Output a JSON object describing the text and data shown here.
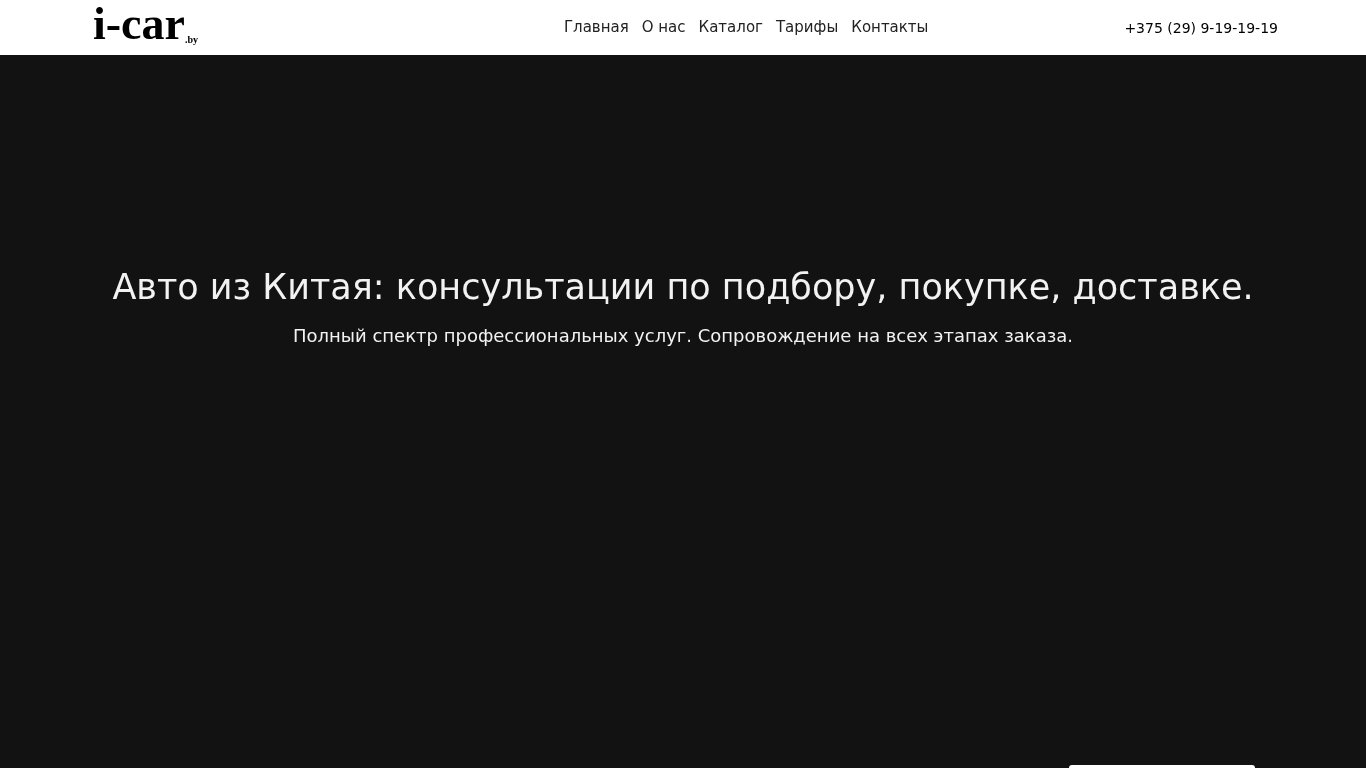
{
  "header": {
    "logo": {
      "name": "i-car",
      "suffix": ".by"
    },
    "nav": [
      {
        "label": "Главная"
      },
      {
        "label": "О нас"
      },
      {
        "label": "Каталог"
      },
      {
        "label": "Тарифы"
      },
      {
        "label": "Контакты"
      }
    ],
    "phone": "+375 (29) 9-19-19-19"
  },
  "hero": {
    "title": "Авто из Китая: консультации по подбору, покупке, доставке.",
    "subtitle": "Полный спектр профессиональных услуг. Сопровождение на всех этапах заказа."
  }
}
